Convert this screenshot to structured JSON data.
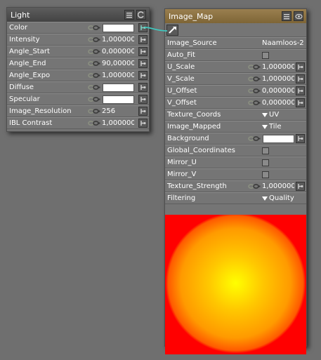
{
  "light_node": {
    "title": "Light",
    "rows": [
      {
        "label": "Color",
        "value": "",
        "type": "color",
        "plug_connected": true
      },
      {
        "label": "Intensity",
        "value": "1,000000",
        "type": "number"
      },
      {
        "label": "Angle_Start",
        "value": "0,000000",
        "type": "number"
      },
      {
        "label": "Angle_End",
        "value": "90,000000",
        "type": "number"
      },
      {
        "label": "Angle_Expo",
        "value": "1,000000",
        "type": "number"
      },
      {
        "label": "Diffuse",
        "value": "",
        "type": "color"
      },
      {
        "label": "Specular",
        "value": "",
        "type": "color"
      },
      {
        "label": "Image_Resolution",
        "value": "256",
        "type": "number"
      },
      {
        "label": "IBL Contrast",
        "value": "1,000000",
        "type": "number"
      }
    ]
  },
  "image_map_node": {
    "title": "Image_Map",
    "rows": [
      {
        "label": "Image_Source",
        "value": "Naamloos-2",
        "type": "text"
      },
      {
        "label": "Auto_Fit",
        "value": "",
        "type": "checkbox"
      },
      {
        "label": "U_Scale",
        "value": "1,000000",
        "type": "number"
      },
      {
        "label": "V_Scale",
        "value": "1,000000",
        "type": "number"
      },
      {
        "label": "U_Offset",
        "value": "0,000000",
        "type": "number"
      },
      {
        "label": "V_Offset",
        "value": "0,000000",
        "type": "number"
      },
      {
        "label": "Texture_Coords",
        "value": "UV",
        "type": "dropdown"
      },
      {
        "label": "Image_Mapped",
        "value": "Tile",
        "type": "dropdown"
      },
      {
        "label": "Background",
        "value": "",
        "type": "color"
      },
      {
        "label": "Global_Coordinates",
        "value": "",
        "type": "checkbox"
      },
      {
        "label": "Mirror_U",
        "value": "",
        "type": "checkbox"
      },
      {
        "label": "Mirror_V",
        "value": "",
        "type": "checkbox"
      },
      {
        "label": "Texture_Strength",
        "value": "1,000000",
        "type": "number"
      },
      {
        "label": "Filtering",
        "value": "Quality",
        "type": "dropdown"
      }
    ]
  },
  "colors": {
    "background": "#6f6f6f",
    "light_header": "#4e4e4e",
    "image_map_header": "#8c7244",
    "connection_wire": "#3fc9c0",
    "preview_outer": "#ff0000",
    "preview_center": "#ffff00"
  }
}
